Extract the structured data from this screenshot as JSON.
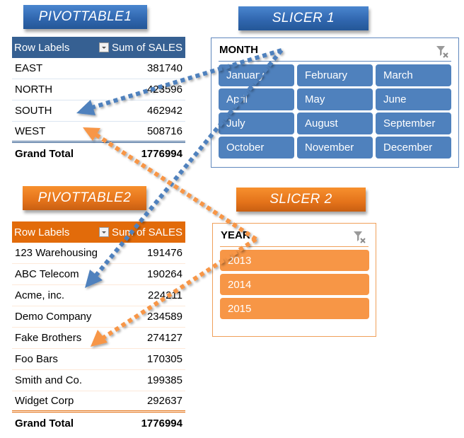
{
  "banners": {
    "pivottable1": "PIVOTTABLE1",
    "slicer1": "SLICER 1",
    "pivottable2": "PIVOTTABLE2",
    "slicer2": "SLICER 2"
  },
  "pivottable1": {
    "header": {
      "row_labels": "Row Labels",
      "value_label": "Sum of SALES"
    },
    "rows": [
      {
        "label": "EAST",
        "value": "381740"
      },
      {
        "label": "NORTH",
        "value": "423596"
      },
      {
        "label": "SOUTH",
        "value": "462942"
      },
      {
        "label": "WEST",
        "value": "508716"
      }
    ],
    "total": {
      "label": "Grand Total",
      "value": "1776994"
    }
  },
  "pivottable2": {
    "header": {
      "row_labels": "Row Labels",
      "value_label": "Sum of SALES"
    },
    "rows": [
      {
        "label": "123 Warehousing",
        "value": "191476"
      },
      {
        "label": "ABC Telecom",
        "value": "190264"
      },
      {
        "label": "Acme, inc.",
        "value": "224211"
      },
      {
        "label": "Demo Company",
        "value": "234589"
      },
      {
        "label": "Fake Brothers",
        "value": "274127"
      },
      {
        "label": "Foo Bars",
        "value": "170305"
      },
      {
        "label": "Smith and Co.",
        "value": "199385"
      },
      {
        "label": "Widget Corp",
        "value": "292637"
      }
    ],
    "total": {
      "label": "Grand Total",
      "value": "1776994"
    }
  },
  "slicer1": {
    "title": "MONTH",
    "clear_icon": "clear-filter-icon",
    "items": [
      "January",
      "February",
      "March",
      "April",
      "May",
      "June",
      "July",
      "August",
      "September",
      "October",
      "November",
      "December"
    ]
  },
  "slicer2": {
    "title": "YEAR",
    "clear_icon": "clear-filter-icon",
    "items": [
      "2013",
      "2014",
      "2015"
    ]
  },
  "colors": {
    "blue_accent": "#4f81bd",
    "blue_header": "#366092",
    "orange_accent": "#f79646",
    "orange_header": "#e26b0a"
  }
}
